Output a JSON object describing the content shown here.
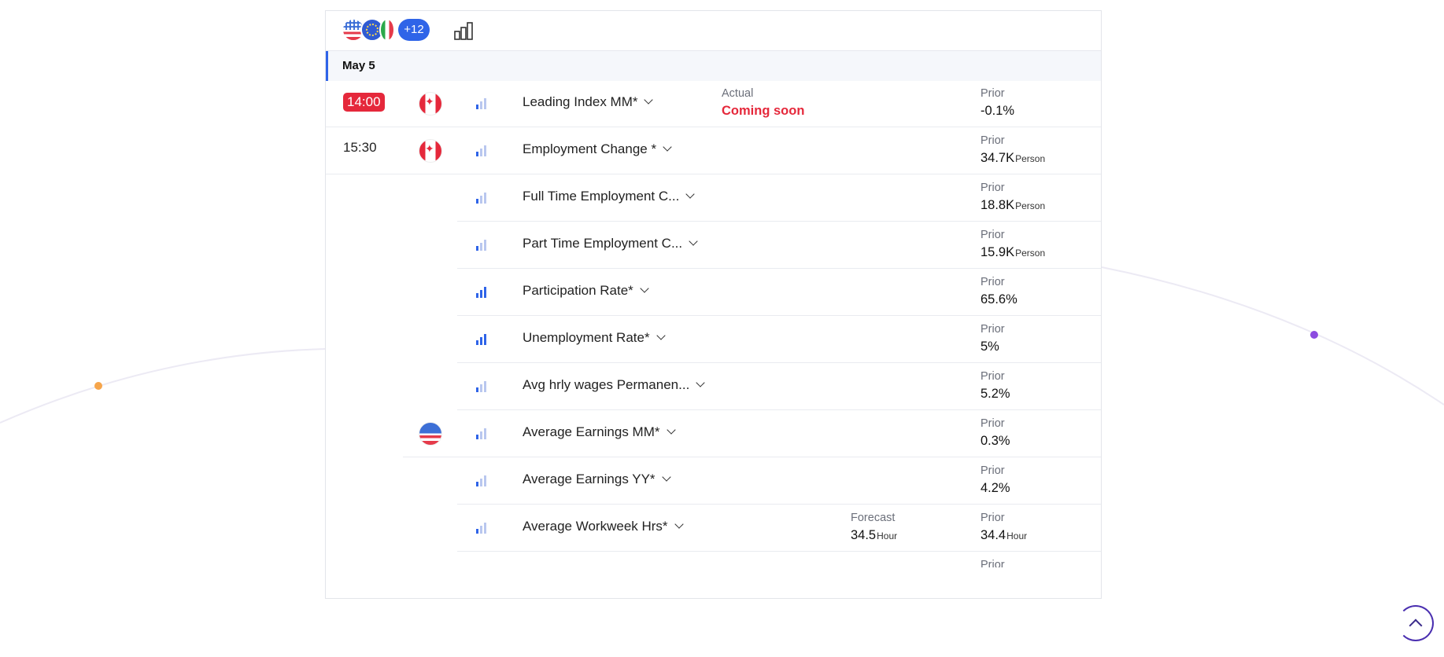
{
  "toolbar": {
    "flags": [
      "us-flag-icon",
      "eu-flag-icon",
      "it-flag-icon"
    ],
    "more_countries": "+12",
    "importance_filter_icon": "bar-chart-icon"
  },
  "date_label": "May 5",
  "columns": {
    "actual": "Actual",
    "forecast": "Forecast",
    "prior": "Prior"
  },
  "events": [
    {
      "time": "14:00",
      "time_highlight": true,
      "country": "canada",
      "importance": 1,
      "name": "Leading Index MM*",
      "actual": "Coming soon",
      "forecast": "",
      "forecast_unit": "",
      "prior": "-0.1%",
      "prior_unit": ""
    },
    {
      "time": "15:30",
      "time_highlight": false,
      "country": "canada",
      "importance": 1,
      "name": "Employment Change *",
      "actual": "",
      "forecast": "",
      "forecast_unit": "",
      "prior": "34.7K",
      "prior_unit": "Person"
    },
    {
      "time": "",
      "time_highlight": false,
      "country": "",
      "importance": 1,
      "name": "Full Time Employment C...",
      "actual": "",
      "forecast": "",
      "forecast_unit": "",
      "prior": "18.8K",
      "prior_unit": "Person"
    },
    {
      "time": "",
      "time_highlight": false,
      "country": "",
      "importance": 1,
      "name": "Part Time Employment C...",
      "actual": "",
      "forecast": "",
      "forecast_unit": "",
      "prior": "15.9K",
      "prior_unit": "Person"
    },
    {
      "time": "",
      "time_highlight": false,
      "country": "",
      "importance": 3,
      "name": "Participation Rate*",
      "actual": "",
      "forecast": "",
      "forecast_unit": "",
      "prior": "65.6%",
      "prior_unit": ""
    },
    {
      "time": "",
      "time_highlight": false,
      "country": "",
      "importance": 3,
      "name": "Unemployment Rate*",
      "actual": "",
      "forecast": "",
      "forecast_unit": "",
      "prior": "5%",
      "prior_unit": ""
    },
    {
      "time": "",
      "time_highlight": false,
      "country": "",
      "importance": 1,
      "name": "Avg hrly wages Permanen...",
      "actual": "",
      "forecast": "",
      "forecast_unit": "",
      "prior": "5.2%",
      "prior_unit": ""
    },
    {
      "time": "",
      "time_highlight": false,
      "country": "united-states",
      "importance": 1,
      "name": "Average Earnings MM*",
      "actual": "",
      "forecast": "",
      "forecast_unit": "",
      "prior": "0.3%",
      "prior_unit": ""
    },
    {
      "time": "",
      "time_highlight": false,
      "country": "",
      "importance": 1,
      "name": "Average Earnings YY*",
      "actual": "",
      "forecast": "",
      "forecast_unit": "",
      "prior": "4.2%",
      "prior_unit": ""
    },
    {
      "time": "",
      "time_highlight": false,
      "country": "",
      "importance": 1,
      "name": "Average Workweek Hrs*",
      "actual": "",
      "forecast": "34.5",
      "forecast_unit": "Hour",
      "prior": "34.4",
      "prior_unit": "Hour"
    }
  ],
  "partial_next_label": "Prior",
  "colors": {
    "accent": "#2f64e8",
    "highlight": "#e5283b",
    "arc_dot_orange": "#f6a54b",
    "arc_dot_purple": "#8c4be0"
  }
}
